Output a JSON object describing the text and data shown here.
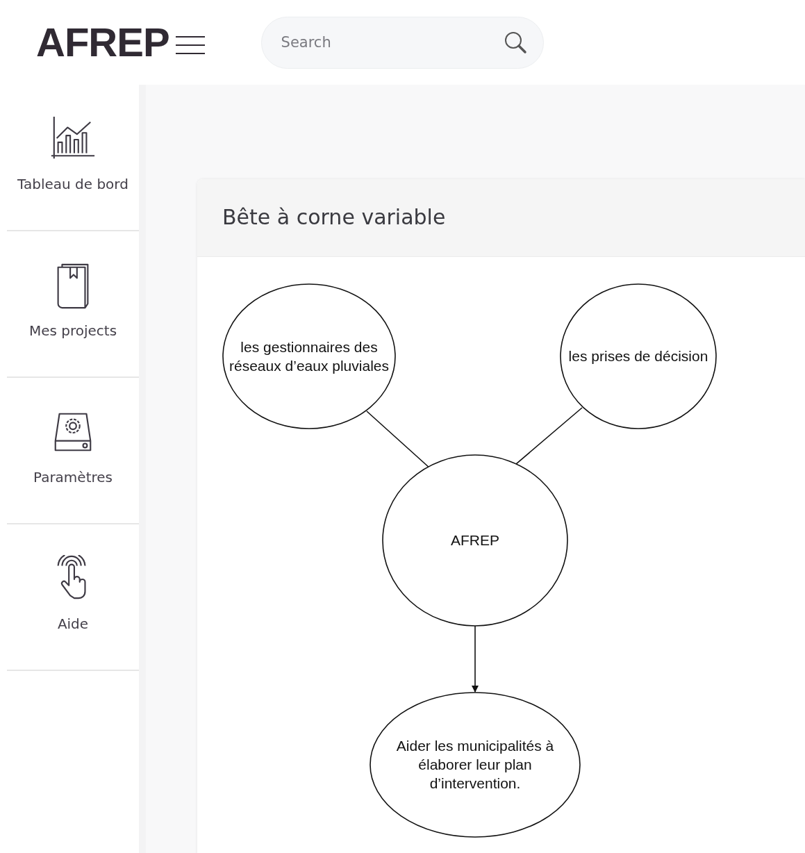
{
  "header": {
    "logo": "AFREP",
    "search": {
      "placeholder": "Search"
    }
  },
  "sidebar": {
    "items": [
      {
        "label": "Tableau de bord"
      },
      {
        "label": "Mes projects"
      },
      {
        "label": "Paramètres"
      },
      {
        "label": "Aide"
      }
    ]
  },
  "card": {
    "title": "Bête à corne variable",
    "diagram": {
      "nodes": [
        {
          "lines": [
            "les gestionnaires des",
            "réseaux d’eaux pluviales"
          ]
        },
        {
          "lines": [
            "les prises de décision"
          ]
        },
        {
          "lines": [
            "AFREP"
          ]
        },
        {
          "lines": [
            "Aider les municipalités à",
            "élaborer leur plan",
            "d’intervention."
          ]
        }
      ],
      "edges": [
        {
          "kind": "line"
        },
        {
          "kind": "line"
        },
        {
          "kind": "arrow"
        }
      ]
    }
  }
}
